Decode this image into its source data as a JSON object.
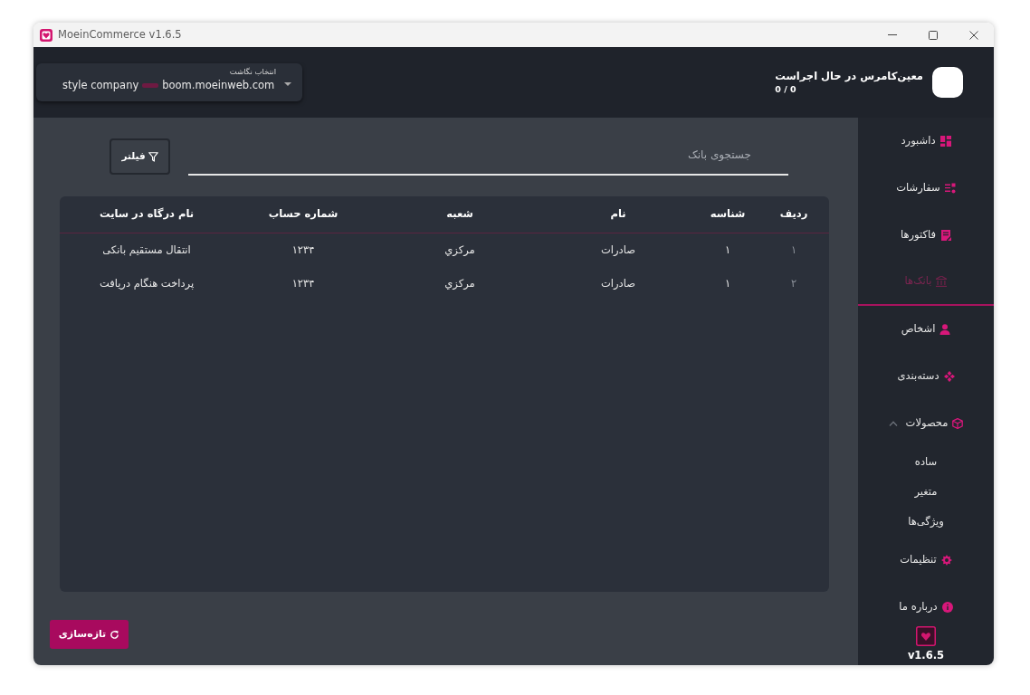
{
  "window": {
    "title": "MoeinCommerce v1.6.5"
  },
  "header": {
    "mapping_select": {
      "label": "انتخاب نگاشت",
      "company": "style company",
      "site": "boom.moeinweb.com"
    },
    "status": {
      "title": "معین‌کامرس در حال اجراست",
      "count": "0 / 0"
    }
  },
  "sidebar": {
    "items": [
      {
        "label": "داشبورد",
        "selected": false
      },
      {
        "label": "سفارشات",
        "selected": false
      },
      {
        "label": "فاکتورها",
        "selected": false
      },
      {
        "label": "بانک‌ها",
        "selected": true
      },
      {
        "label": "اشخاص",
        "selected": false
      },
      {
        "label": "دسته‌بندی",
        "selected": false
      },
      {
        "label": "محصولات",
        "selected": false,
        "expanded": true,
        "children": [
          {
            "label": "ساده",
            "selected": false
          },
          {
            "label": "متغیر",
            "selected": false
          },
          {
            "label": "ویژگی‌ها",
            "selected": false
          }
        ]
      },
      {
        "label": "تنظیمات",
        "selected": false
      },
      {
        "label": "درباره ما",
        "selected": false
      }
    ],
    "version": "v1.6.5"
  },
  "search": {
    "placeholder": "جستجوی بانک"
  },
  "filter_button": {
    "label": "فیلتر"
  },
  "table": {
    "columns": [
      "ردیف",
      "شناسه",
      "نام",
      "شعبه",
      "شماره حساب",
      "نام درگاه در سایت"
    ],
    "rows": [
      [
        "١",
        "۱",
        "صادرات",
        "مرکزي",
        "۱۲۳۴",
        "انتقال مستقیم بانکی"
      ],
      [
        "٢",
        "۱",
        "صادرات",
        "مرکزي",
        "۱۲۳۴",
        "پرداخت هنگام دریافت"
      ]
    ]
  },
  "refresh_button": {
    "label": "تازه‌سازی"
  }
}
